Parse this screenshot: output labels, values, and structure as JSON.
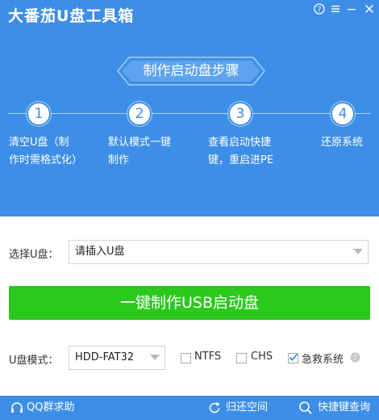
{
  "app": {
    "title": "大番茄U盘工具箱"
  },
  "banner": {
    "text": "制作启动盘步骤"
  },
  "steps": [
    {
      "num": "1",
      "line1": "清空U盘（制",
      "line2": "作时需格式化）"
    },
    {
      "num": "2",
      "line1": "默认模式一键",
      "line2": "制作"
    },
    {
      "num": "3",
      "line1": "查看启动快捷",
      "line2": "键，重启进PE"
    },
    {
      "num": "4",
      "line1": "还原系统",
      "line2": ""
    }
  ],
  "usb_select": {
    "label": "选择U盘：",
    "value": "请插入U盘"
  },
  "make_button": {
    "label": "一键制作USB启动盘"
  },
  "mode": {
    "label": "U盘模式：",
    "value": "HDD-FAT32"
  },
  "options": [
    {
      "label": "NTFS",
      "checked": false
    },
    {
      "label": "CHS",
      "checked": false
    },
    {
      "label": "急救系统",
      "checked": true
    }
  ],
  "footer": {
    "qq": "QQ群求助",
    "restore": "归还空间",
    "shortcut": "快捷键查询"
  },
  "colors": {
    "primary": "#3d8ee6",
    "button": "#2dc81e"
  },
  "icons": [
    "help-icon",
    "menu-icon",
    "minimize-icon",
    "close-icon",
    "chevron-down-icon",
    "check-icon",
    "info-icon",
    "headset-icon",
    "refresh-icon",
    "search-icon"
  ]
}
